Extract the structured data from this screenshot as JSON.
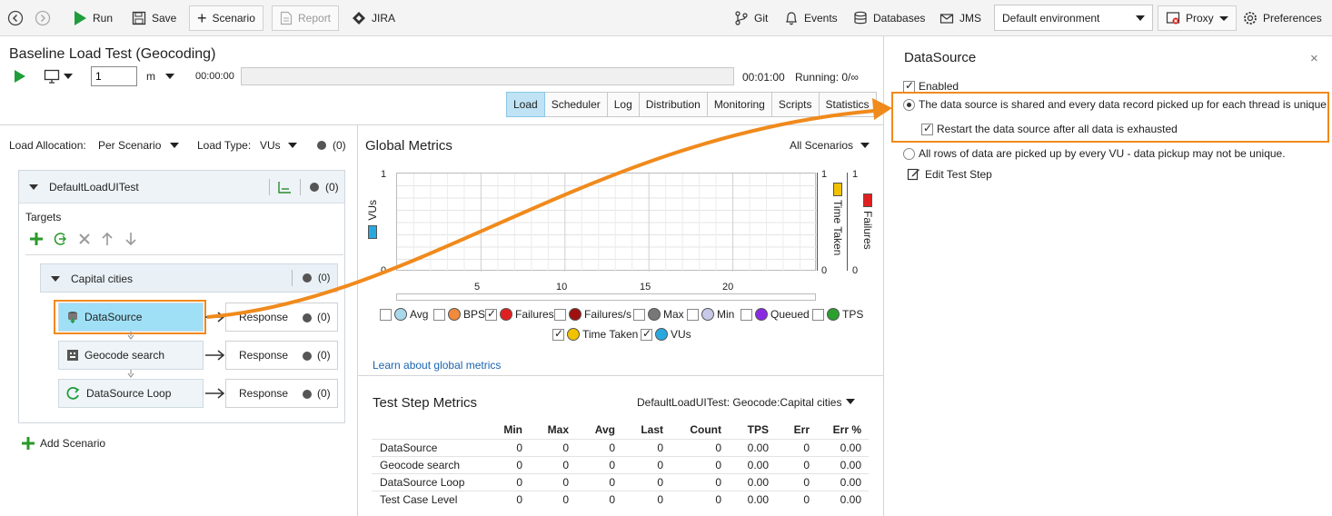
{
  "toolbar": {
    "run": "Run",
    "save": "Save",
    "scenario": "Scenario",
    "report": "Report",
    "jira": "JIRA",
    "git": "Git",
    "events": "Events",
    "databases": "Databases",
    "jms": "JMS",
    "environment": "Default environment",
    "proxy": "Proxy",
    "preferences": "Preferences"
  },
  "test": {
    "title": "Baseline Load Test (Geocoding)",
    "duration_value": "1",
    "duration_unit": "m",
    "elapsed": "00:00:00",
    "total": "00:01:00",
    "running": "Running: 0/∞"
  },
  "tabs": [
    "Load",
    "Scheduler",
    "Log",
    "Distribution",
    "Monitoring",
    "Scripts",
    "Statistics"
  ],
  "load": {
    "allocation_label": "Load Allocation:",
    "allocation_value": "Per Scenario",
    "type_label": "Load Type:",
    "type_value": "VUs",
    "count": "(0)"
  },
  "loadtest": {
    "name": "DefaultLoadUITest",
    "count": "(0)",
    "targets_label": "Targets",
    "scenario_name": "Capital cities",
    "scenario_count": "(0)",
    "steps": [
      {
        "name": "DataSource",
        "response": "Response",
        "count": "(0)"
      },
      {
        "name": "Geocode search",
        "response": "Response",
        "count": "(0)"
      },
      {
        "name": "DataSource Loop",
        "response": "Response",
        "count": "(0)"
      }
    ],
    "add_scenario": "Add Scenario"
  },
  "global_metrics": {
    "title": "Global Metrics",
    "scope": "All Scenarios",
    "learn_link": "Learn about global metrics"
  },
  "chart_data": {
    "type": "line",
    "x_ticks": [
      "5",
      "10",
      "15",
      "20"
    ],
    "xlim": [
      0,
      25
    ],
    "y_left": {
      "label": "VUs",
      "max": "1",
      "min": "0"
    },
    "y_right1": {
      "label": "Time Taken",
      "max": "1",
      "min": "0"
    },
    "y_right2": {
      "label": "Failures",
      "max": "1",
      "min": "0"
    },
    "grid": true,
    "series": [],
    "colors": {
      "vus": "#29a8e0",
      "time_taken": "#f2c200",
      "failures": "#e02020"
    }
  },
  "legend": [
    {
      "label": "Avg",
      "checked": false,
      "color": "#a8d8ea"
    },
    {
      "label": "BPS",
      "checked": false,
      "color": "#f08a3c"
    },
    {
      "label": "Failures",
      "checked": true,
      "color": "#e02020"
    },
    {
      "label": "Failures/s",
      "checked": false,
      "color": "#a01010"
    },
    {
      "label": "Max",
      "checked": false,
      "color": "#777777"
    },
    {
      "label": "Min",
      "checked": false,
      "color": "#c8c8e8"
    },
    {
      "label": "Queued",
      "checked": false,
      "color": "#8a2be2"
    },
    {
      "label": "TPS",
      "checked": false,
      "color": "#2ca02c"
    },
    {
      "label": "Time Taken",
      "checked": true,
      "color": "#f2c200"
    },
    {
      "label": "VUs",
      "checked": true,
      "color": "#29a8e0"
    }
  ],
  "step_metrics": {
    "title": "Test Step Metrics",
    "scope": "DefaultLoadUITest: Geocode:Capital cities",
    "columns": [
      "",
      "Min",
      "Max",
      "Avg",
      "Last",
      "Count",
      "TPS",
      "Err",
      "Err %"
    ],
    "rows": [
      [
        "DataSource",
        "0",
        "0",
        "0",
        "0",
        "0",
        "0.00",
        "0",
        "0.00"
      ],
      [
        "Geocode search",
        "0",
        "0",
        "0",
        "0",
        "0",
        "0.00",
        "0",
        "0.00"
      ],
      [
        "DataSource Loop",
        "0",
        "0",
        "0",
        "0",
        "0",
        "0.00",
        "0",
        "0.00"
      ],
      [
        "Test Case Level",
        "0",
        "0",
        "0",
        "0",
        "0",
        "0.00",
        "0",
        "0.00"
      ]
    ]
  },
  "datasource_panel": {
    "title": "DataSource",
    "enabled_label": "Enabled",
    "option_shared": "The data source is shared and every data record picked up for each thread is unique",
    "restart_label": "Restart the data source after all data is exhausted",
    "option_all_rows": "All rows of data are picked up by every VU - data pickup may not be unique.",
    "edit_step": "Edit Test Step"
  }
}
